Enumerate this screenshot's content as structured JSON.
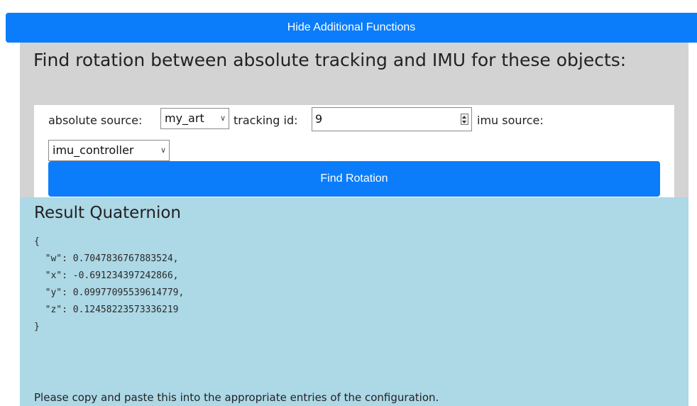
{
  "toggle_button": {
    "label": "Hide Additional Functions"
  },
  "rotation": {
    "title": "Find rotation between absolute tracking and IMU for these objects:",
    "absolute_source_label": "absolute source:",
    "absolute_source_value": "my_art",
    "tracking_id_label": "tracking id:",
    "tracking_id_value": "9",
    "imu_source_label": "imu source:",
    "imu_source_value": "imu_controller",
    "find_button_label": "Find Rotation"
  },
  "result": {
    "title": "Result Quaternion",
    "lines": [
      "{",
      "  \"w\": 0.7047836767883524,",
      "  \"x\": -0.691234397242866,",
      "  \"y\": 0.09977095539614779,",
      "  \"z\": 0.12458223573336219",
      "}"
    ],
    "note": "Please copy and paste this into the appropriate entries of the configuration."
  }
}
